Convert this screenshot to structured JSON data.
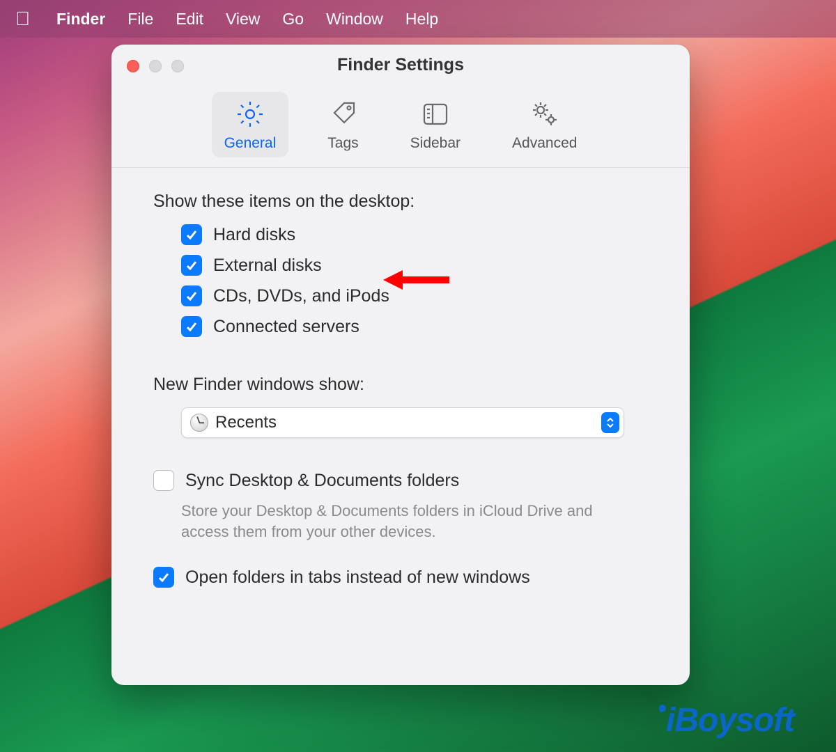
{
  "menubar": {
    "app": "Finder",
    "items": [
      "File",
      "Edit",
      "View",
      "Go",
      "Window",
      "Help"
    ]
  },
  "window": {
    "title": "Finder Settings",
    "tabs": [
      {
        "id": "general",
        "label": "General",
        "icon": "gear-icon",
        "active": true
      },
      {
        "id": "tags",
        "label": "Tags",
        "icon": "tag-icon",
        "active": false
      },
      {
        "id": "sidebar",
        "label": "Sidebar",
        "icon": "sidebar-icon",
        "active": false
      },
      {
        "id": "advanced",
        "label": "Advanced",
        "icon": "gears-icon",
        "active": false
      }
    ]
  },
  "general": {
    "desktop_items_label": "Show these items on the desktop:",
    "desktop_items": [
      {
        "label": "Hard disks",
        "checked": true
      },
      {
        "label": "External disks",
        "checked": true
      },
      {
        "label": "CDs, DVDs, and iPods",
        "checked": true
      },
      {
        "label": "Connected servers",
        "checked": true
      }
    ],
    "new_windows_label": "New Finder windows show:",
    "new_windows_value": "Recents",
    "sync": {
      "label": "Sync Desktop & Documents folders",
      "checked": false,
      "help": "Store your Desktop & Documents folders in iCloud Drive and access them from your other devices."
    },
    "open_in_tabs": {
      "label": "Open folders in tabs instead of new windows",
      "checked": true
    }
  },
  "annotation": {
    "points_to": "External disks"
  },
  "watermark": "iBoysoft"
}
